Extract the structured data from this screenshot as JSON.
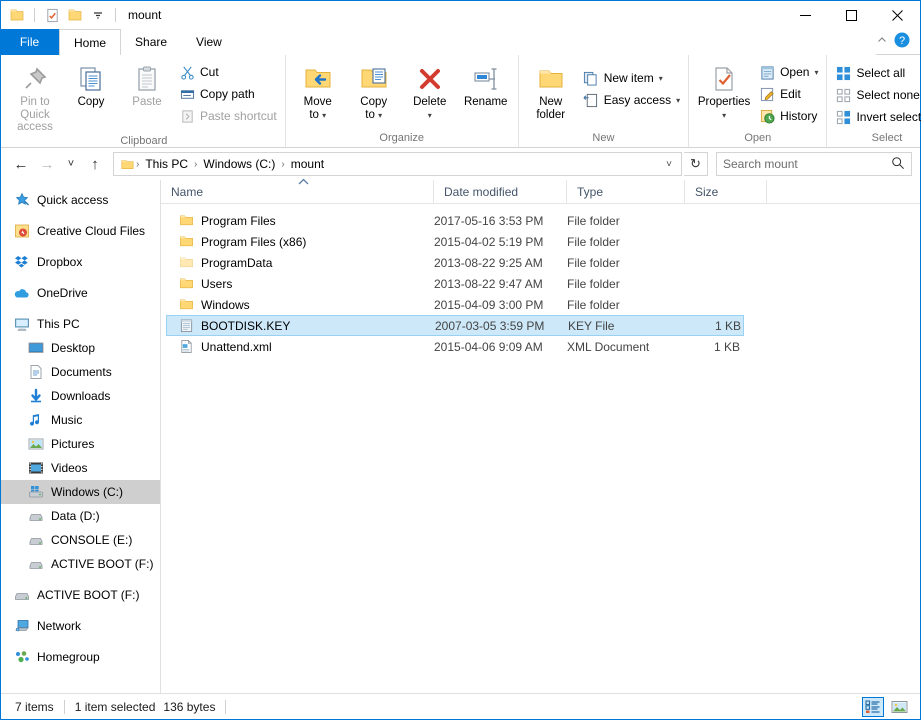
{
  "window": {
    "title": "mount",
    "quick_access": [
      "folder-icon",
      "properties-icon",
      "new-folder-icon",
      "customize-dropdown-icon"
    ],
    "controls": {
      "minimize": "–",
      "maximize": "☐",
      "close": "✕"
    }
  },
  "tabs": [
    {
      "label": "File",
      "id": "file"
    },
    {
      "label": "Home",
      "id": "home"
    },
    {
      "label": "Share",
      "id": "share"
    },
    {
      "label": "View",
      "id": "view"
    }
  ],
  "active_tab": "Home",
  "ribbon": {
    "groups": [
      {
        "label": "Clipboard",
        "big": [
          {
            "label_l1": "Pin to Quick",
            "label_l2": "access",
            "icon": "pin-icon",
            "dim": true
          },
          {
            "label_l1": "Copy",
            "label_l2": "",
            "icon": "copy-icon",
            "dim": false
          },
          {
            "label_l1": "Paste",
            "label_l2": "",
            "icon": "paste-icon",
            "dim": true
          }
        ],
        "small": [
          {
            "label": "Cut",
            "icon": "cut-icon",
            "dim": false
          },
          {
            "label": "Copy path",
            "icon": "copy-path-icon",
            "dim": false
          },
          {
            "label": "Paste shortcut",
            "icon": "paste-shortcut-icon",
            "dim": true
          }
        ]
      },
      {
        "label": "Organize",
        "big": [
          {
            "label_l1": "Move",
            "label_l2": "to",
            "icon": "move-to-icon",
            "dropdown": true
          },
          {
            "label_l1": "Copy",
            "label_l2": "to",
            "icon": "copy-to-icon",
            "dropdown": true
          },
          {
            "label_l1": "Delete",
            "label_l2": "",
            "icon": "delete-icon",
            "dropdown": true
          },
          {
            "label_l1": "Rename",
            "label_l2": "",
            "icon": "rename-icon",
            "dropdown": false
          }
        ],
        "small": []
      },
      {
        "label": "New",
        "big": [
          {
            "label_l1": "New",
            "label_l2": "folder",
            "icon": "new-folder-icon",
            "dropdown": false
          }
        ],
        "small": [
          {
            "label": "New item",
            "icon": "new-item-icon",
            "dropdown": true
          },
          {
            "label": "Easy access",
            "icon": "easy-access-icon",
            "dropdown": true
          }
        ]
      },
      {
        "label": "Open",
        "big": [
          {
            "label_l1": "Properties",
            "label_l2": "",
            "icon": "properties-icon",
            "dropdown": true
          }
        ],
        "small": [
          {
            "label": "Open",
            "icon": "open-icon",
            "dropdown": true
          },
          {
            "label": "Edit",
            "icon": "edit-icon",
            "dropdown": false
          },
          {
            "label": "History",
            "icon": "history-icon",
            "dropdown": false
          }
        ]
      },
      {
        "label": "Select",
        "big": [],
        "small": [
          {
            "label": "Select all",
            "icon": "select-all-icon"
          },
          {
            "label": "Select none",
            "icon": "select-none-icon"
          },
          {
            "label": "Invert selection",
            "icon": "invert-selection-icon"
          }
        ]
      }
    ]
  },
  "address": {
    "back": "←",
    "forward": "→",
    "recent": "˅",
    "up": "↑",
    "breadcrumbs": [
      "This PC",
      "Windows (C:)",
      "mount"
    ],
    "separator": "›",
    "dropdown": "˅",
    "refresh": "↻"
  },
  "search": {
    "placeholder": "Search mount",
    "icon": "search-icon"
  },
  "sidebar": {
    "items": [
      {
        "label": "Quick access",
        "icon": "star-pin-icon",
        "indent": false,
        "selected": false,
        "gap_after": true
      },
      {
        "label": "Creative Cloud Files",
        "icon": "creative-cloud-icon",
        "indent": false,
        "selected": false,
        "gap_after": true
      },
      {
        "label": "Dropbox",
        "icon": "dropbox-icon",
        "indent": false,
        "selected": false,
        "gap_after": true
      },
      {
        "label": "OneDrive",
        "icon": "onedrive-icon",
        "indent": false,
        "selected": false,
        "gap_after": true
      },
      {
        "label": "This PC",
        "icon": "this-pc-icon",
        "indent": false,
        "selected": false,
        "gap_after": false
      },
      {
        "label": "Desktop",
        "icon": "desktop-icon",
        "indent": true,
        "selected": false,
        "gap_after": false
      },
      {
        "label": "Documents",
        "icon": "documents-icon",
        "indent": true,
        "selected": false,
        "gap_after": false
      },
      {
        "label": "Downloads",
        "icon": "downloads-icon",
        "indent": true,
        "selected": false,
        "gap_after": false
      },
      {
        "label": "Music",
        "icon": "music-icon",
        "indent": true,
        "selected": false,
        "gap_after": false
      },
      {
        "label": "Pictures",
        "icon": "pictures-icon",
        "indent": true,
        "selected": false,
        "gap_after": false
      },
      {
        "label": "Videos",
        "icon": "videos-icon",
        "indent": true,
        "selected": false,
        "gap_after": false
      },
      {
        "label": "Windows (C:)",
        "icon": "local-disk-icon",
        "indent": true,
        "selected": true,
        "gap_after": false
      },
      {
        "label": "Data (D:)",
        "icon": "drive-icon",
        "indent": true,
        "selected": false,
        "gap_after": false
      },
      {
        "label": "CONSOLE (E:)",
        "icon": "drive-icon",
        "indent": true,
        "selected": false,
        "gap_after": false
      },
      {
        "label": "ACTIVE BOOT (F:)",
        "icon": "drive-icon",
        "indent": true,
        "selected": false,
        "gap_after": true
      },
      {
        "label": "ACTIVE BOOT (F:)",
        "icon": "drive-icon",
        "indent": false,
        "selected": false,
        "gap_after": true
      },
      {
        "label": "Network",
        "icon": "network-icon",
        "indent": false,
        "selected": false,
        "gap_after": true
      },
      {
        "label": "Homegroup",
        "icon": "homegroup-icon",
        "indent": false,
        "selected": false,
        "gap_after": false
      }
    ]
  },
  "filelist": {
    "columns": [
      "Name",
      "Date modified",
      "Type",
      "Size"
    ],
    "sort_column": "Name",
    "sort_direction": "ascending",
    "rows": [
      {
        "name": "Program Files",
        "date": "2017-05-16 3:53 PM",
        "type": "File folder",
        "size": "",
        "icon": "folder-icon",
        "selected": false
      },
      {
        "name": "Program Files (x86)",
        "date": "2015-04-02 5:19 PM",
        "type": "File folder",
        "size": "",
        "icon": "folder-icon",
        "selected": false
      },
      {
        "name": "ProgramData",
        "date": "2013-08-22 9:25 AM",
        "type": "File folder",
        "size": "",
        "icon": "folder-faded-icon",
        "selected": false
      },
      {
        "name": "Users",
        "date": "2013-08-22 9:47 AM",
        "type": "File folder",
        "size": "",
        "icon": "folder-icon",
        "selected": false
      },
      {
        "name": "Windows",
        "date": "2015-04-09 3:00 PM",
        "type": "File folder",
        "size": "",
        "icon": "folder-icon",
        "selected": false
      },
      {
        "name": "BOOTDISK.KEY",
        "date": "2007-03-05 3:59 PM",
        "type": "KEY File",
        "size": "1 KB",
        "icon": "notepad-file-icon",
        "selected": true
      },
      {
        "name": "Unattend.xml",
        "date": "2015-04-06 9:09 AM",
        "type": "XML Document",
        "size": "1 KB",
        "icon": "xml-file-icon",
        "selected": false
      }
    ]
  },
  "statusbar": {
    "item_count": "7 items",
    "selection": "1 item selected",
    "selection_size": "136 bytes",
    "views": [
      {
        "name": "details-view",
        "active": true
      },
      {
        "name": "large-icons-view",
        "active": false
      }
    ]
  },
  "colors": {
    "accent": "#0078d7",
    "selection_bg": "#cce8f9",
    "selection_border": "#99d1f2",
    "folder_yellow": "#ffd775",
    "header_text": "#44546a"
  }
}
